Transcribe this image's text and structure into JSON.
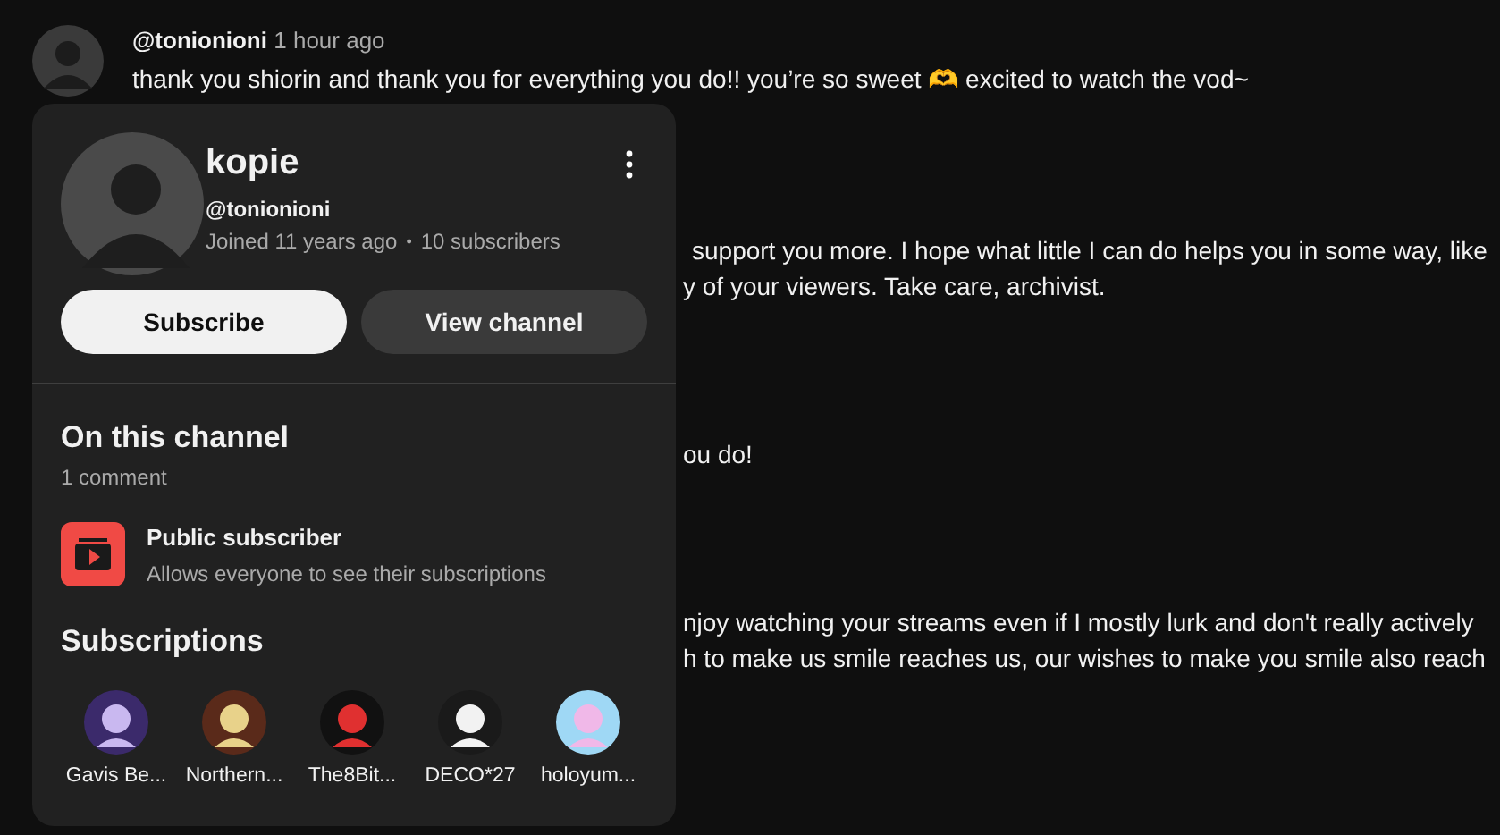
{
  "comments": [
    {
      "author": "@tonionioni",
      "time": "1 hour ago",
      "lines": [
        "thank you shiorin and thank you for everything you do!! you’re so sweet 🫶 excited to watch the vod~"
      ]
    },
    {
      "lines": [
        "support you more. I hope what little I can do helps you in some way, like",
        "y of your viewers. Take care, archivist."
      ]
    },
    {
      "lines": [
        "ou do!"
      ]
    },
    {
      "lines": [
        "njoy watching your streams even if I mostly lurk and don't really actively",
        "h to make us smile reaches us, our wishes to make you smile also reach"
      ]
    }
  ],
  "card": {
    "name": "kopie",
    "handle": "@tonionioni",
    "joined": "Joined 11 years ago",
    "separator": "•",
    "subscribers": "10 subscribers",
    "buttons": [
      {
        "label": "Subscribe",
        "kind": "primary"
      },
      {
        "label": "View channel",
        "kind": "secondary"
      }
    ],
    "section_title": "On this channel",
    "comment_count": "1 comment",
    "badge": {
      "title": "Public subscriber",
      "description": "Allows everyone to see their subscriptions"
    },
    "subscriptions_title": "Subscriptions",
    "subscriptions": [
      {
        "name": "Gavis Be..."
      },
      {
        "name": "Northern..."
      },
      {
        "name": "The8Bit..."
      },
      {
        "name": "DECO*27"
      },
      {
        "name": "holoyum..."
      }
    ]
  }
}
